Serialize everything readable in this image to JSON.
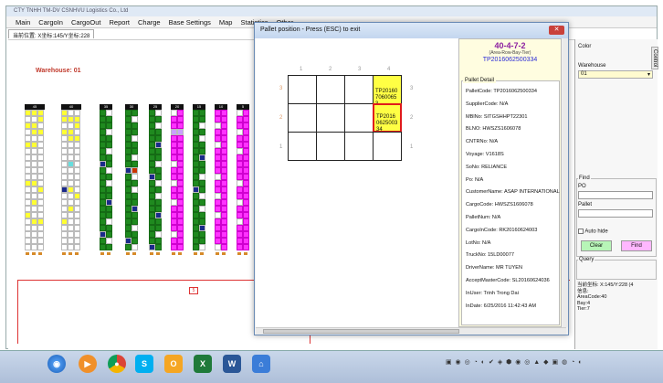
{
  "app": {
    "title": "CTY TNHH TM-DV CSNHVU Logistics Co., Ltd",
    "menu": [
      "Main",
      "CargoIn",
      "CargoOut",
      "Report",
      "Charge",
      "Base Settings",
      "Map",
      "Statistics",
      "Other"
    ],
    "doc_tab": "当前位置: X坐标:145/Y坐标:228",
    "warehouse_label": "Warehouse: 01",
    "zone_marker": "5",
    "rack_labels": [
      "45",
      "40",
      "35",
      "30",
      "25",
      "20",
      "15",
      "10",
      "5",
      "1"
    ]
  },
  "right_panel": {
    "color_label": "Color",
    "control_tab": "Control",
    "warehouse_label": "Warehouse",
    "warehouse_value": "01",
    "find_label": "Find",
    "po_label": "PO",
    "pallet_label": "Pallet",
    "auto_hide_label": "Auto hide",
    "clear_label": "Clear",
    "find_button": "Find",
    "query_label": "Query",
    "info_coord": "当前坐标: X:145/Y:228 (4",
    "info_info": "信息:",
    "info_area": "AreaCode:40",
    "info_bay": "Bay:4",
    "info_tier": "Tier:7"
  },
  "dialog": {
    "title": "Pallet position - Press (ESC) to exit",
    "close_glyph": "✕",
    "columns": [
      "1",
      "2",
      "3",
      "4"
    ],
    "rows": [
      "3",
      "2",
      "1"
    ],
    "cell_4_3": "TP2016070600653",
    "cell_4_2": "TP2016062500334"
  },
  "detail": {
    "code": "40-4-7-2",
    "subtitle": "(Area-Row-Bay-Tier)",
    "pallet": "TP2016062500334",
    "legend": "Pallet Detail",
    "fields": [
      "PalletCode: TP2016062500334",
      "SupplierCode: N/A",
      "MBlNo: SITGSHHPT22301",
      "BLNO: HWSZS1606078",
      "CNTRNo: N/A",
      "Voyage: V1618S",
      "SoNo: RELIANCE",
      "Po: N/A",
      "CustomerName: ASAP INTERNATIONAL",
      "CargoCode: HWSZS1606078",
      "PalletNum: N/A",
      "CargoInCode: RK20160624003",
      "LotNo: N/A",
      "TruckNo: 15LD00077",
      "DriverName: MR TUYEN",
      "AcceptMasterCode: SL20160624036",
      "InUser: Trinh Trong Dai",
      "InDate: 6/25/2016 11:42:43 AM"
    ]
  },
  "taskbar": {
    "buttons": [
      "start-orb-icon",
      "media-player-icon",
      "chrome-icon",
      "skype-icon",
      "outlook-icon",
      "excel-icon",
      "word-icon",
      "warehouse-app-icon"
    ]
  },
  "colors": {
    "yellow": "#ffff33",
    "green": "#1f8a1f",
    "magenta": "#ff33ff",
    "selected_border": "#e01b1b",
    "code_purple": "#8b1fa0"
  }
}
